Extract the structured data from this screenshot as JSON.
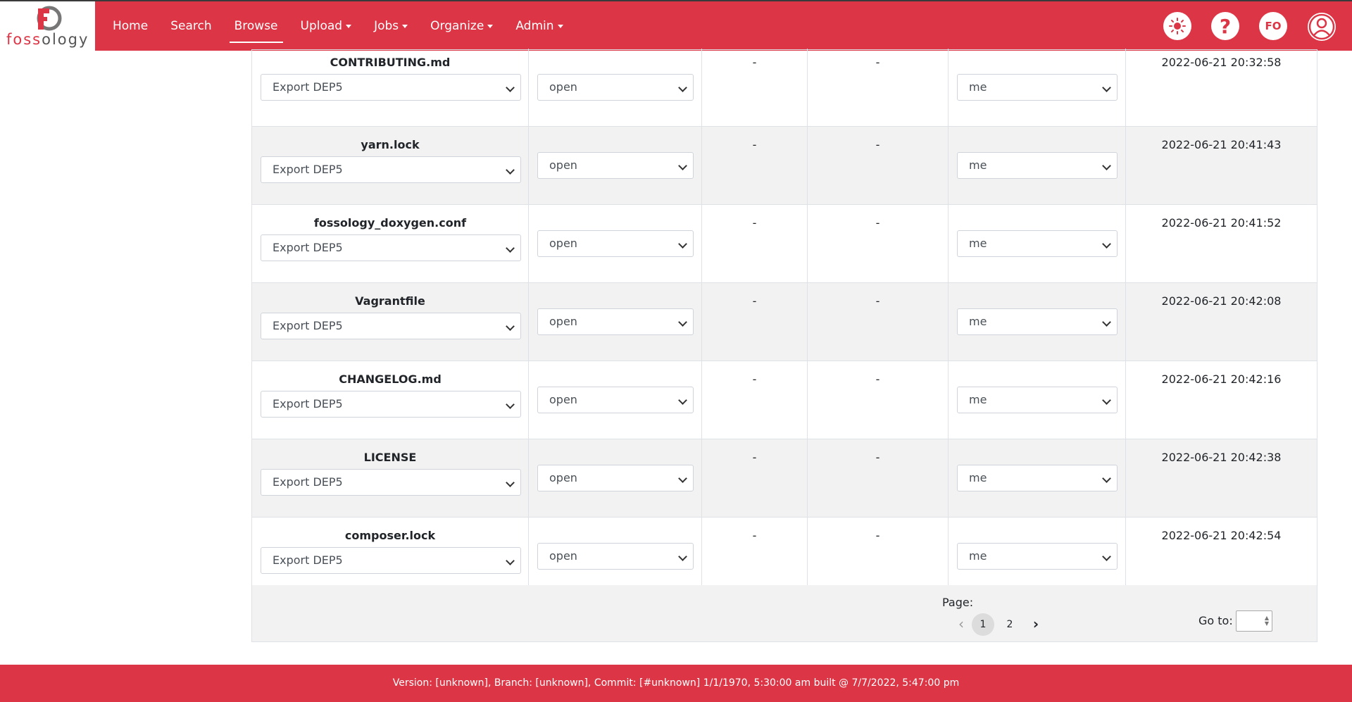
{
  "brand": {
    "logo_text_red": "foss",
    "logo_text_gray": "ology"
  },
  "nav": {
    "home": "Home",
    "search": "Search",
    "browse": "Browse",
    "upload": "Upload",
    "jobs": "Jobs",
    "organize": "Organize",
    "admin": "Admin"
  },
  "user": {
    "initials": "FO"
  },
  "rows": [
    {
      "name": "CONTRIBUTING.md",
      "action": "Export DEP5",
      "status": "open",
      "col3": "-",
      "col4": "-",
      "assignee": "me",
      "date": "2022-06-21 20:32:58"
    },
    {
      "name": "yarn.lock",
      "action": "Export DEP5",
      "status": "open",
      "col3": "-",
      "col4": "-",
      "assignee": "me",
      "date": "2022-06-21 20:41:43"
    },
    {
      "name": "fossology_doxygen.conf",
      "action": "Export DEP5",
      "status": "open",
      "col3": "-",
      "col4": "-",
      "assignee": "me",
      "date": "2022-06-21 20:41:52"
    },
    {
      "name": "Vagrantfile",
      "action": "Export DEP5",
      "status": "open",
      "col3": "-",
      "col4": "-",
      "assignee": "me",
      "date": "2022-06-21 20:42:08"
    },
    {
      "name": "CHANGELOG.md",
      "action": "Export DEP5",
      "status": "open",
      "col3": "-",
      "col4": "-",
      "assignee": "me",
      "date": "2022-06-21 20:42:16"
    },
    {
      "name": "LICENSE",
      "action": "Export DEP5",
      "status": "open",
      "col3": "-",
      "col4": "-",
      "assignee": "me",
      "date": "2022-06-21 20:42:38"
    },
    {
      "name": "composer.lock",
      "action": "Export DEP5",
      "status": "open",
      "col3": "-",
      "col4": "-",
      "assignee": "me",
      "date": "2022-06-21 20:42:54"
    }
  ],
  "pagination": {
    "label": "Page:",
    "pages": [
      "1",
      "2"
    ],
    "current": "1",
    "goto_label": "Go to:"
  },
  "footer": {
    "text": "Version: [unknown], Branch: [unknown], Commit: [#unknown] 1/1/1970, 5:30:00 am built @ 7/7/2022, 5:47:00 pm"
  },
  "colors": {
    "accent": "#dc3545"
  },
  "icons": {
    "theme": "sun-icon",
    "help": "question-icon",
    "account": "user-circle-icon",
    "prev": "chevron-left-icon",
    "next": "chevron-right-icon"
  }
}
